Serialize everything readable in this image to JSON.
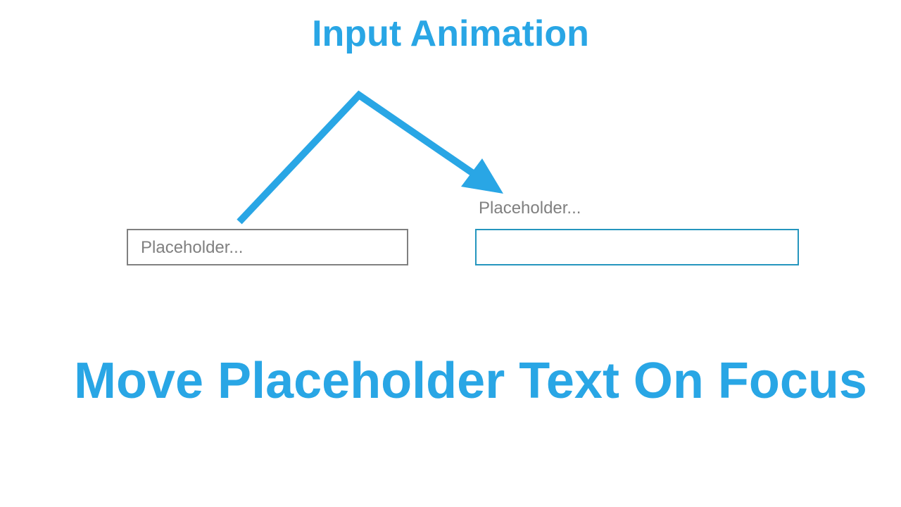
{
  "title": "Input Animation",
  "left_input": {
    "placeholder": "Placeholder..."
  },
  "right_input": {
    "floated_label": "Placeholder..."
  },
  "caption": "Move Placeholder Text On Focus",
  "colors": {
    "accent": "#29a6e5",
    "focus_border": "#2596be",
    "placeholder_gray": "#808080"
  }
}
